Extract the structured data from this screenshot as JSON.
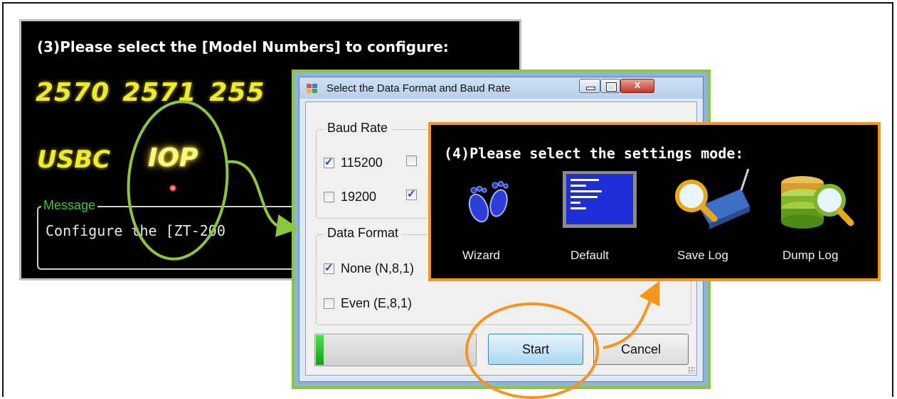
{
  "panel_models": {
    "title": "(3)Please select the [Model Numbers] to configure:",
    "models": [
      "2570",
      "2571",
      "255"
    ],
    "row2": [
      "USBC",
      "IOP"
    ],
    "message_label": "Message",
    "message_text": "Configure the [ZT-200"
  },
  "dialog": {
    "title": "Select the Data Format and Baud Rate",
    "close_glyph": "x",
    "baud_group": "Baud Rate",
    "baud_options": [
      {
        "label": "115200",
        "checked": true
      },
      {
        "label": "",
        "checked": false
      },
      {
        "label": "19200",
        "checked": false
      },
      {
        "label": "",
        "checked": true
      }
    ],
    "format_group": "Data Format",
    "format_options": [
      {
        "label": "None (N,8,1)",
        "checked": true
      },
      {
        "label": "Even (E,8,1)",
        "checked": false
      }
    ],
    "progress_fraction": 0.05,
    "start_label": "Start",
    "cancel_label": "Cancel"
  },
  "panel_settings": {
    "title": "(4)Please select the settings mode:",
    "modes": [
      {
        "label": "Wizard",
        "icon": "footprints-icon"
      },
      {
        "label": "Default",
        "icon": "blue-screen-icon"
      },
      {
        "label": "Save Log",
        "icon": "magnifier-device-icon"
      },
      {
        "label": "Dump Log",
        "icon": "database-magnifier-icon"
      }
    ]
  },
  "colors": {
    "green_annotation": "#8cc63f",
    "orange_annotation": "#f7941d",
    "model_yellow": "#ecec2a",
    "message_green": "#3cc83c"
  }
}
